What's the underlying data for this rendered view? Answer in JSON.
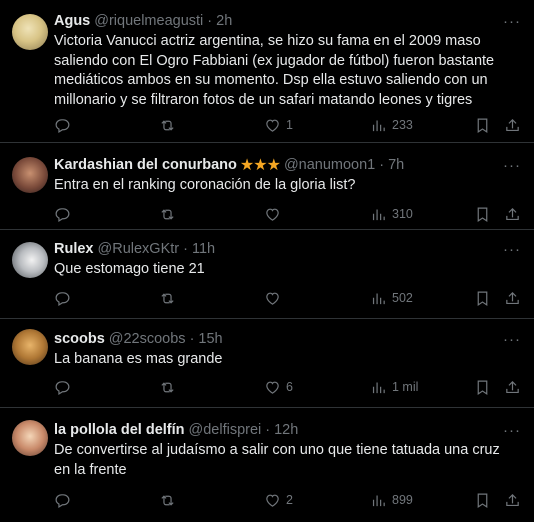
{
  "tweets": [
    {
      "name": "Agus",
      "handle": "@riquelmeagusti",
      "time": "2h",
      "text": "Victoria Vanucci actriz argentina, se hizo su fama en el 2009 maso saliendo con El Ogro Fabbiani (ex jugador de fútbol) fueron bastante mediáticos ambos en su momento. Dsp ella estuvo saliendo con un millonario y se filtraron fotos de un safari matando leones y tigres",
      "likes": "1",
      "views": "233"
    },
    {
      "name": "Kardashian del conurbano",
      "stars": "★★★",
      "handle": "@nanumoon1",
      "time": "7h",
      "text": "Entra en el ranking coronación de la gloria list?",
      "likes": "",
      "views": "310"
    },
    {
      "name": "Rulex",
      "handle": "@RulexGKtr",
      "time": "11h",
      "text": "Que estomago tiene 21",
      "likes": "",
      "views": "502"
    },
    {
      "name": "scoobs",
      "handle": "@22scoobs",
      "time": "15h",
      "text": "La banana es mas grande",
      "likes": "6",
      "views": "1 mil"
    },
    {
      "name": "la pollola del delfín",
      "handle": "@delfisprei",
      "time": "12h",
      "text": "De convertirse al judaísmo a salir con uno que tiene tatuada una cruz en la frente",
      "likes": "2",
      "views": "899"
    }
  ],
  "ui": {
    "dot": "·",
    "more_glyph": "···"
  }
}
